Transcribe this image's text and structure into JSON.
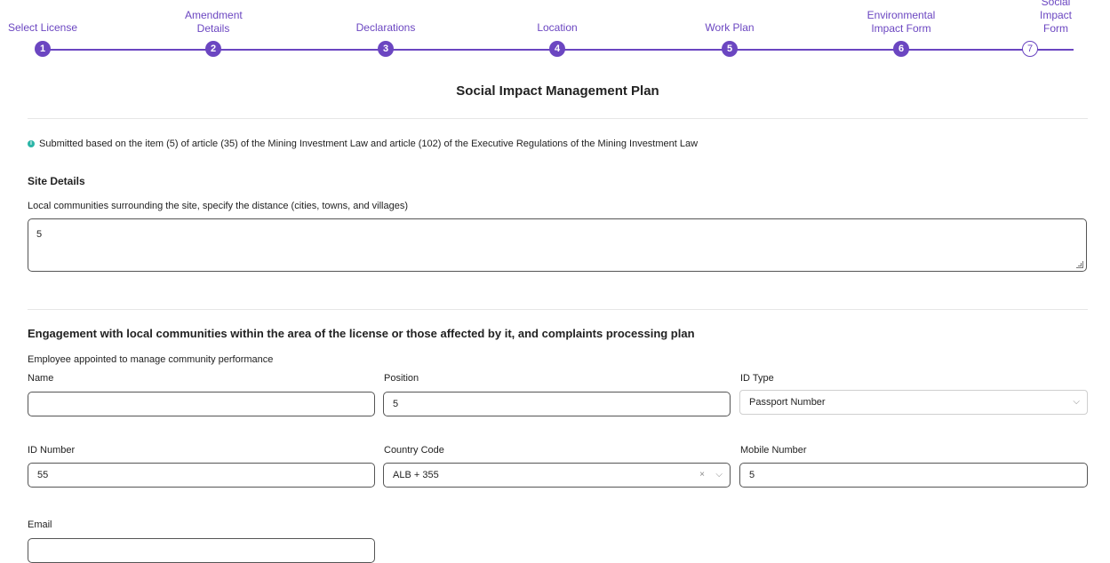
{
  "stepper": {
    "steps": [
      {
        "label": "Select License",
        "num": "1"
      },
      {
        "label": "Amendment Details",
        "num": "2"
      },
      {
        "label": "Declarations",
        "num": "3"
      },
      {
        "label": "Location",
        "num": "4"
      },
      {
        "label": "Work Plan",
        "num": "5"
      },
      {
        "label": "Environmental Impact Form",
        "num": "6"
      },
      {
        "label": "Social Impact Form",
        "num": "7"
      }
    ]
  },
  "page": {
    "title": "Social Impact Management Plan",
    "info_note": "Submitted based on the item (5) of article (35) of the Mining Investment Law and article (102) of the Executive Regulations of the Mining Investment Law"
  },
  "site_details": {
    "heading": "Site Details",
    "communities_label": "Local communities surrounding the site, specify the distance (cities, towns, and villages)",
    "communities_value": "5"
  },
  "engagement": {
    "heading": "Engagement with local communities within the area of the license or those affected by it, and complaints processing plan",
    "subheading": "Employee appointed to manage community performance",
    "name_label": "Name",
    "name_value": "",
    "position_label": "Position",
    "position_value": "5",
    "id_type_label": "ID Type",
    "id_type_value": "Passport Number",
    "id_number_label": "ID Number",
    "id_number_value": "55",
    "country_code_label": "Country Code",
    "country_code_value": "ALB + 355",
    "mobile_label": "Mobile Number",
    "mobile_value": "5",
    "email_label": "Email",
    "email_value": ""
  },
  "icons": {
    "clear": "×",
    "chevron": "⌵",
    "info": "i"
  },
  "colors": {
    "accent": "#6b46c1",
    "info": "#2bb5a7"
  }
}
